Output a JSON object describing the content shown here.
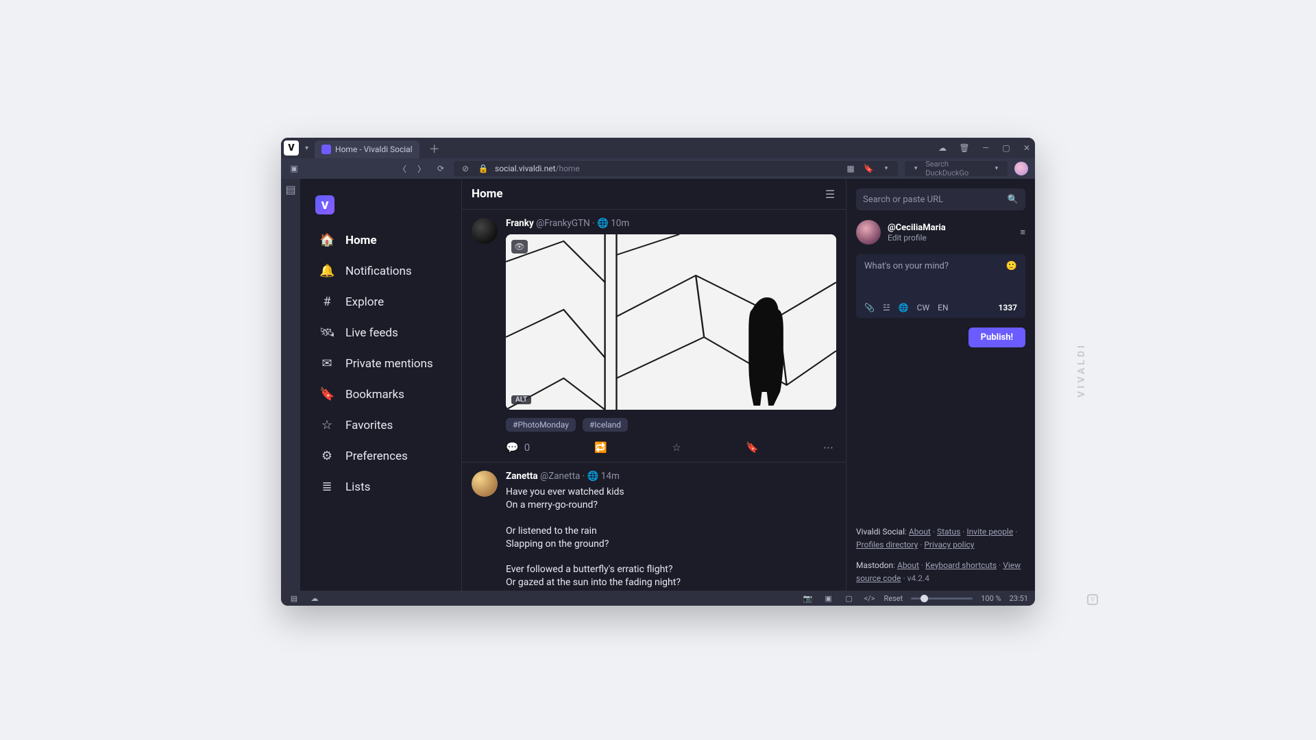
{
  "window": {
    "tab_title": "Home - Vivaldi Social",
    "url_host": "social.vivaldi.net",
    "url_path": "/home",
    "search_hint": "Search DuckDuckGo"
  },
  "nav": {
    "items": [
      {
        "id": "home",
        "label": "Home",
        "icon": "🏠",
        "active": true
      },
      {
        "id": "notifications",
        "label": "Notifications",
        "icon": "🔔"
      },
      {
        "id": "explore",
        "label": "Explore",
        "icon": "#"
      },
      {
        "id": "livefeeds",
        "label": "Live feeds",
        "icon": "🛰"
      },
      {
        "id": "mentions",
        "label": "Private mentions",
        "icon": "✉"
      },
      {
        "id": "bookmarks",
        "label": "Bookmarks",
        "icon": "🔖"
      },
      {
        "id": "favorites",
        "label": "Favorites",
        "icon": "☆"
      },
      {
        "id": "preferences",
        "label": "Preferences",
        "icon": "⚙"
      },
      {
        "id": "lists",
        "label": "Lists",
        "icon": "≣"
      }
    ]
  },
  "feed": {
    "title": "Home",
    "posts": [
      {
        "name": "Franky",
        "handle": "@FrankyGTN",
        "age": "10m",
        "alt_label": "ALT",
        "tags": [
          "#PhotoMonday",
          "#Iceland"
        ],
        "reply_count": "0"
      },
      {
        "name": "Zanetta",
        "handle": "@Zanetta",
        "age": "14m",
        "text": "Have you ever watched kids\nOn a merry-go-round?\n\nOr listened to the rain\nSlapping on the ground?\n\nEver followed a butterfly's erratic flight?\nOr gazed at the sun into the fading night?\n\nYou better slow down."
      }
    ]
  },
  "right": {
    "search_hint": "Search or paste URL",
    "profile_handle": "@CeciliaMaria",
    "edit_profile": "Edit profile",
    "compose_hint": "What's on your mind?",
    "cw": "CW",
    "en": "EN",
    "char_count": "1337",
    "publish": "Publish!",
    "footer": {
      "vivaldi_label": "Vivaldi Social",
      "about": "About",
      "status": "Status",
      "invite": "Invite people",
      "profiles_dir": "Profiles directory",
      "privacy": "Privacy policy",
      "mastodon_label": "Mastodon",
      "kbd": "Keyboard shortcuts",
      "source": "View source code",
      "version": "v4.2.4"
    }
  },
  "status": {
    "reset": "Reset",
    "zoom": "100 %",
    "clock": "23:51"
  },
  "watermark": "VIVALDI"
}
